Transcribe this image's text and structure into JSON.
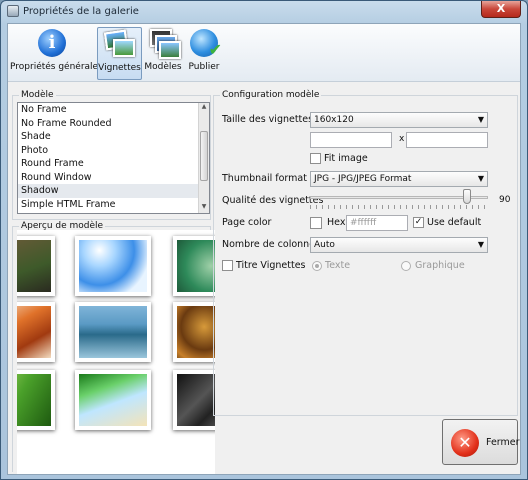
{
  "window": {
    "title": "Propriétés de la galerie",
    "close_glyph": "X"
  },
  "toolbar": {
    "items": [
      {
        "label": "Propriétés générales",
        "icon": "info-icon"
      },
      {
        "label": "Vignettes",
        "icon": "thumbnails-icon",
        "active": true
      },
      {
        "label": "Modèles",
        "icon": "templates-icon"
      },
      {
        "label": "Publier",
        "icon": "publish-icon"
      }
    ]
  },
  "models": {
    "title": "Modèle",
    "items": [
      "No Frame",
      "No Frame Rounded",
      "Shade",
      "Photo",
      "Round Frame",
      "Round Window",
      "Shadow",
      "Simple HTML Frame"
    ],
    "selected": "Shadow"
  },
  "preview": {
    "title": "Aperçu de modèle"
  },
  "config": {
    "title": "Configuration modèle",
    "thumb_size": {
      "label": "Taille des vignettes",
      "value": "160x120",
      "width": "",
      "height": "",
      "x_sep": "x"
    },
    "fit_image": {
      "label": "Fit image",
      "checked": false
    },
    "thumb_format": {
      "label": "Thumbnail format",
      "value": "JPG - JPG/JPEG Format"
    },
    "quality": {
      "label": "Qualité des vignettes",
      "value": "90"
    },
    "page_color": {
      "label": "Page color",
      "hex_label": "Hex",
      "hex_placeholder": "#ffffff",
      "use_default_label": "Use default",
      "use_default_checked": true
    },
    "columns": {
      "label": "Nombre de colonnes",
      "value": "Auto"
    },
    "title_vignettes": {
      "label": "Titre Vignettes",
      "checked": false,
      "radio_text": "Texte",
      "radio_graphic": "Graphique"
    }
  },
  "footer": {
    "close_label": "Fermer"
  },
  "colors": {
    "accent": "#3399ff",
    "close_red": "#c9473a"
  }
}
